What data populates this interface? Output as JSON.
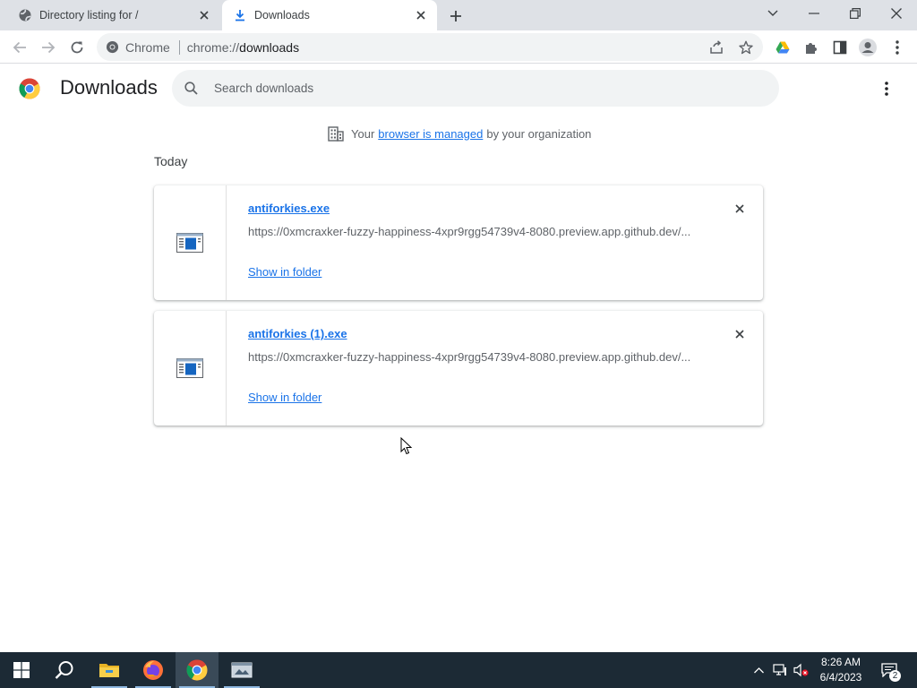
{
  "browser": {
    "tabs": [
      {
        "title": "Directory listing for /",
        "active": false,
        "icon": "globe-icon"
      },
      {
        "title": "Downloads",
        "active": true,
        "icon": "download-icon"
      }
    ],
    "omnibox": {
      "chip_label": "Chrome",
      "url_scheme": "chrome://",
      "url_host": "downloads"
    }
  },
  "downloads_page": {
    "title": "Downloads",
    "search_placeholder": "Search downloads",
    "managed_notice": {
      "prefix": "Your",
      "link": "browser is managed",
      "suffix": "by your organization"
    },
    "section_label": "Today",
    "items": [
      {
        "file_name": "antiforkies.exe",
        "url": "https://0xmcraxker-fuzzy-happiness-4xpr9rgg54739v4-8080.preview.app.github.dev/...",
        "action_label": "Show in folder"
      },
      {
        "file_name": "antiforkies (1).exe",
        "url": "https://0xmcraxker-fuzzy-happiness-4xpr9rgg54739v4-8080.preview.app.github.dev/...",
        "action_label": "Show in folder"
      }
    ]
  },
  "taskbar": {
    "time": "8:26 AM",
    "date": "6/4/2023",
    "notification_count": "2"
  },
  "colors": {
    "link": "#1a73e8",
    "tabstrip": "#dee1e6",
    "taskbar": "#1c2a35"
  }
}
